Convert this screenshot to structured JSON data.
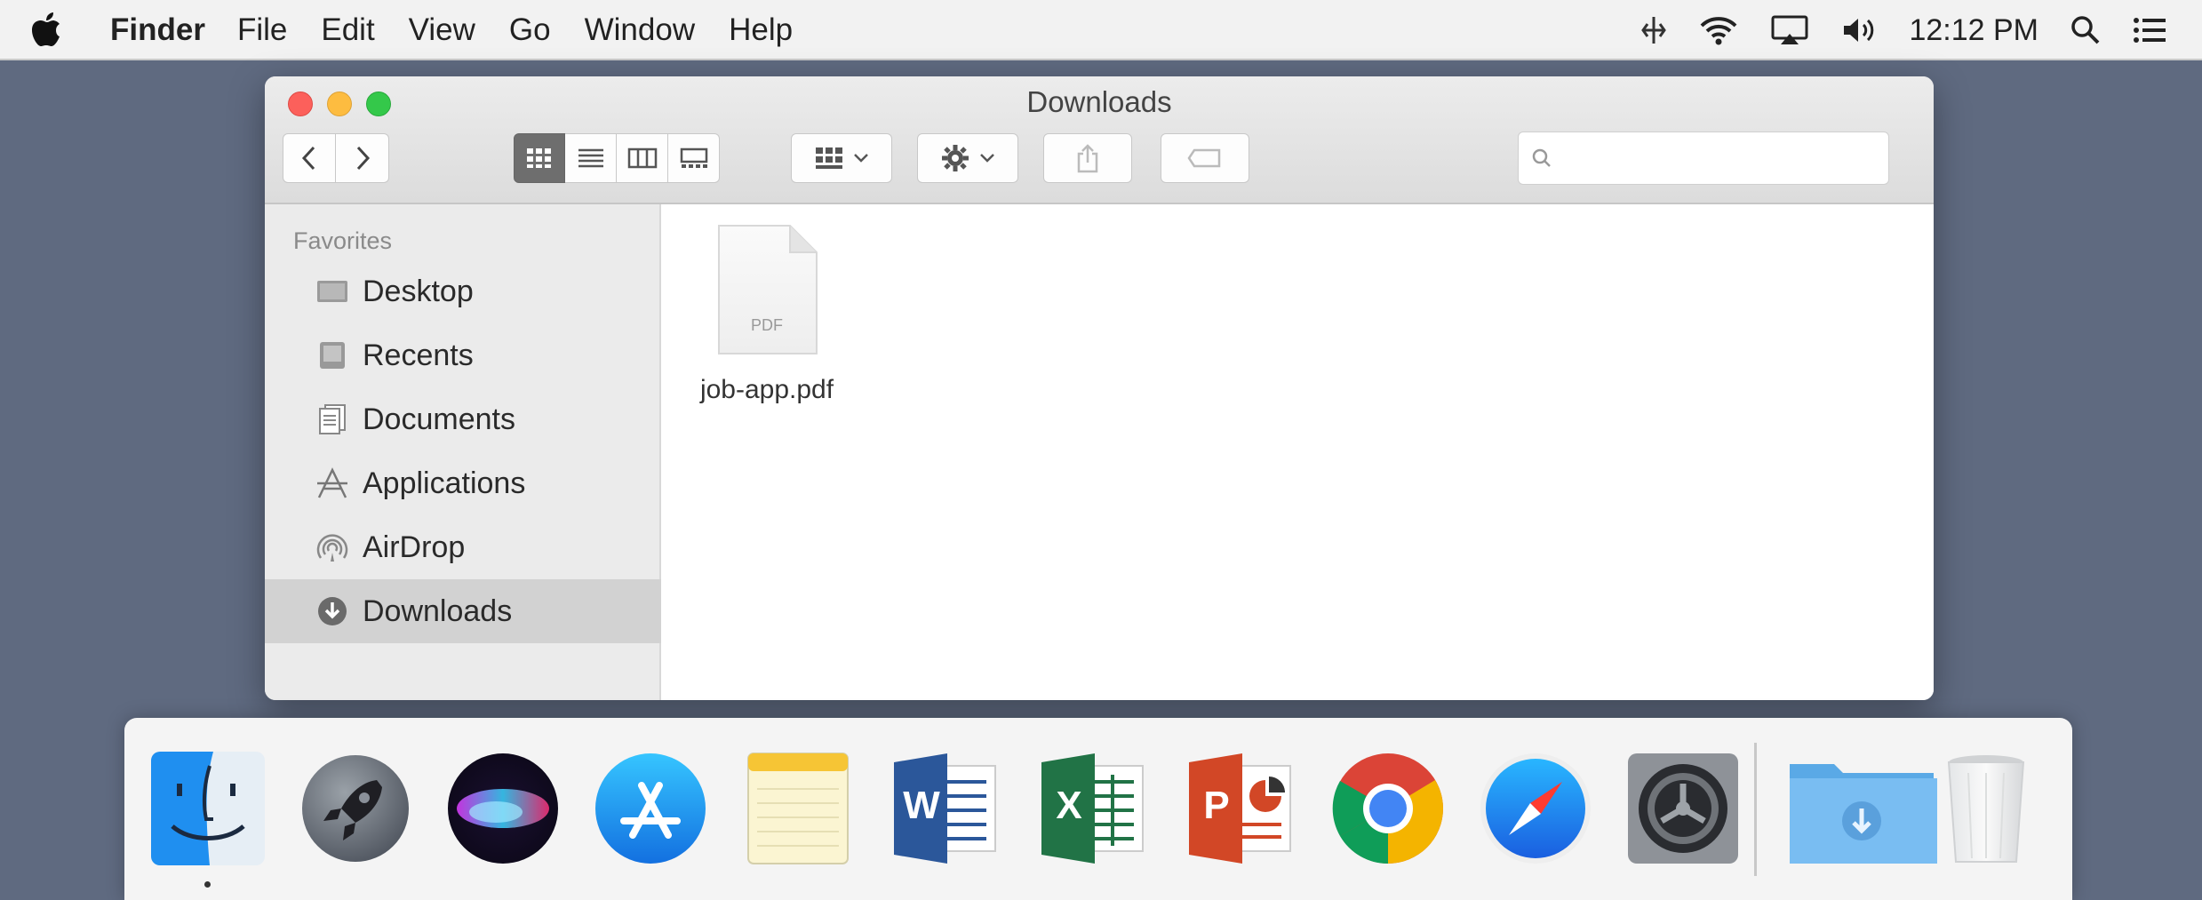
{
  "menubar": {
    "app_name": "Finder",
    "items": [
      "File",
      "Edit",
      "View",
      "Go",
      "Window",
      "Help"
    ],
    "status_icons": [
      "sync-icon",
      "wifi-icon",
      "airplay-icon",
      "volume-icon"
    ],
    "clock": "12:12 PM"
  },
  "window": {
    "title": "Downloads",
    "search": {
      "placeholder": "",
      "value": ""
    },
    "view_mode": "icon"
  },
  "sidebar": {
    "section_title": "Favorites",
    "items": [
      {
        "label": "Desktop",
        "icon": "desktop-icon"
      },
      {
        "label": "Recents",
        "icon": "recents-icon"
      },
      {
        "label": "Documents",
        "icon": "documents-icon"
      },
      {
        "label": "Applications",
        "icon": "applications-icon"
      },
      {
        "label": "AirDrop",
        "icon": "airdrop-icon"
      },
      {
        "label": "Downloads",
        "icon": "downloads-icon",
        "selected": true
      }
    ]
  },
  "files": [
    {
      "name": "job-app.pdf",
      "type_label": "PDF"
    }
  ],
  "dock": {
    "apps": [
      "Finder",
      "Launchpad",
      "Siri",
      "App Store",
      "Notes",
      "Word",
      "Excel",
      "PowerPoint",
      "Chrome",
      "Safari",
      "System Preferences",
      "Downloads",
      "Trash"
    ],
    "letters": {
      "word": "W",
      "excel": "X",
      "powerpoint": "P"
    }
  }
}
